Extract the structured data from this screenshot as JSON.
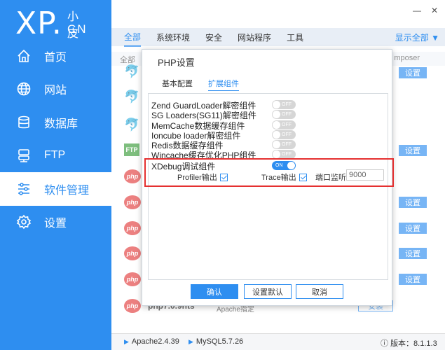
{
  "app": {
    "logo_main": "XP.",
    "logo_small": "小皮",
    "logo_cn": "CN"
  },
  "sidebar": {
    "items": [
      {
        "label": "首页",
        "icon": "home-icon"
      },
      {
        "label": "网站",
        "icon": "globe-icon"
      },
      {
        "label": "数据库",
        "icon": "database-icon"
      },
      {
        "label": "FTP",
        "icon": "server-icon"
      },
      {
        "label": "软件管理",
        "icon": "sliders-icon"
      },
      {
        "label": "设置",
        "icon": "gear-icon"
      }
    ],
    "active_index": 4
  },
  "window": {
    "minimize": "—",
    "close": "✕"
  },
  "tabs": {
    "items": [
      "全部",
      "系统环境",
      "安全",
      "网站程序",
      "工具"
    ],
    "show_all": "显示全部 ▼"
  },
  "list": {
    "header_left": "全部",
    "header_right": "mposer",
    "set_label": "设置",
    "install_label": "安装",
    "php7_name": "php7.0.9nts",
    "php7_desc": "php运行支持程序，请将php版本设置为Apache指定"
  },
  "dialog": {
    "title": "PHP设置",
    "tab_basic": "基本配置",
    "tab_ext": "扩展组件",
    "options": [
      {
        "label": "Zend GuardLoader解密组件",
        "state": "OFF"
      },
      {
        "label": "SG Loaders(SG11)解密组件",
        "state": "OFF"
      },
      {
        "label": "MemCache数据缓存组件",
        "state": "OFF"
      },
      {
        "label": "Ioncube loader解密组件",
        "state": "OFF"
      },
      {
        "label": "Redis数据缓存组件",
        "state": "OFF"
      },
      {
        "label": "Wincache缓存优化PHP组件",
        "state": "OFF"
      },
      {
        "label": "XDebug调试组件",
        "state": "ON"
      }
    ],
    "profiler_label": "Profiler输出",
    "trace_label": "Trace输出",
    "port_label": "端口监听",
    "port_value": "9000",
    "btn_confirm": "确认",
    "btn_default": "设置默认",
    "btn_cancel": "取消"
  },
  "status": {
    "apache": "Apache2.4.39",
    "mysql": "MySQL5.7.26",
    "version": "版本：8.1.1.3"
  },
  "colors": {
    "accent": "#2e8ef0",
    "highlight": "#e53030"
  }
}
